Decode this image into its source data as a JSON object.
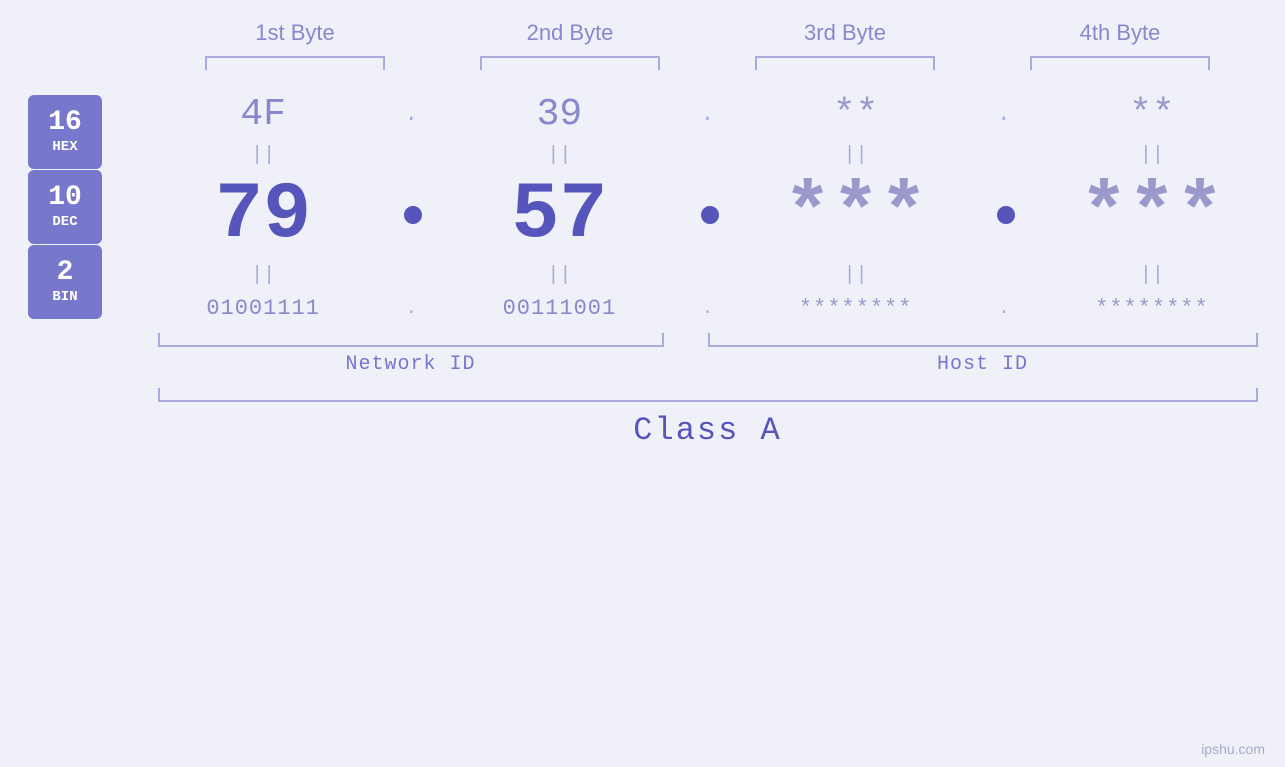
{
  "byteHeaders": [
    "1st Byte",
    "2nd Byte",
    "3rd Byte",
    "4th Byte"
  ],
  "bases": [
    {
      "number": "16",
      "label": "HEX"
    },
    {
      "number": "10",
      "label": "DEC"
    },
    {
      "number": "2",
      "label": "BIN"
    }
  ],
  "hexValues": [
    "4F",
    "39",
    "**",
    "**"
  ],
  "decValues": [
    "79",
    "57",
    "***",
    "***"
  ],
  "binValues": [
    "01001111",
    "00111001",
    "********",
    "********"
  ],
  "networkIdLabel": "Network ID",
  "hostIdLabel": "Host ID",
  "classLabel": "Class A",
  "watermark": "ipshu.com"
}
